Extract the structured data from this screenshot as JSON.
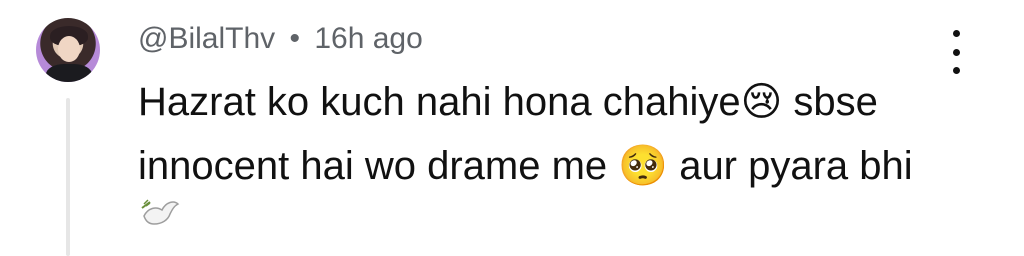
{
  "comment": {
    "username": "@BilalThv",
    "separator": "•",
    "time": "16h ago",
    "line1": "Hazrat ko kuch nahi hona chahiye",
    "emoji_cry": "😢",
    "line1_end": " sbse",
    "line2a": "innocent  hai wo drame me ",
    "emoji_plead": "🥺",
    "line2b": " aur pyara bhi",
    "emoji_dove": "🕊️"
  },
  "icons": {
    "menu": "more-vert-icon",
    "avatar": "user-avatar"
  }
}
